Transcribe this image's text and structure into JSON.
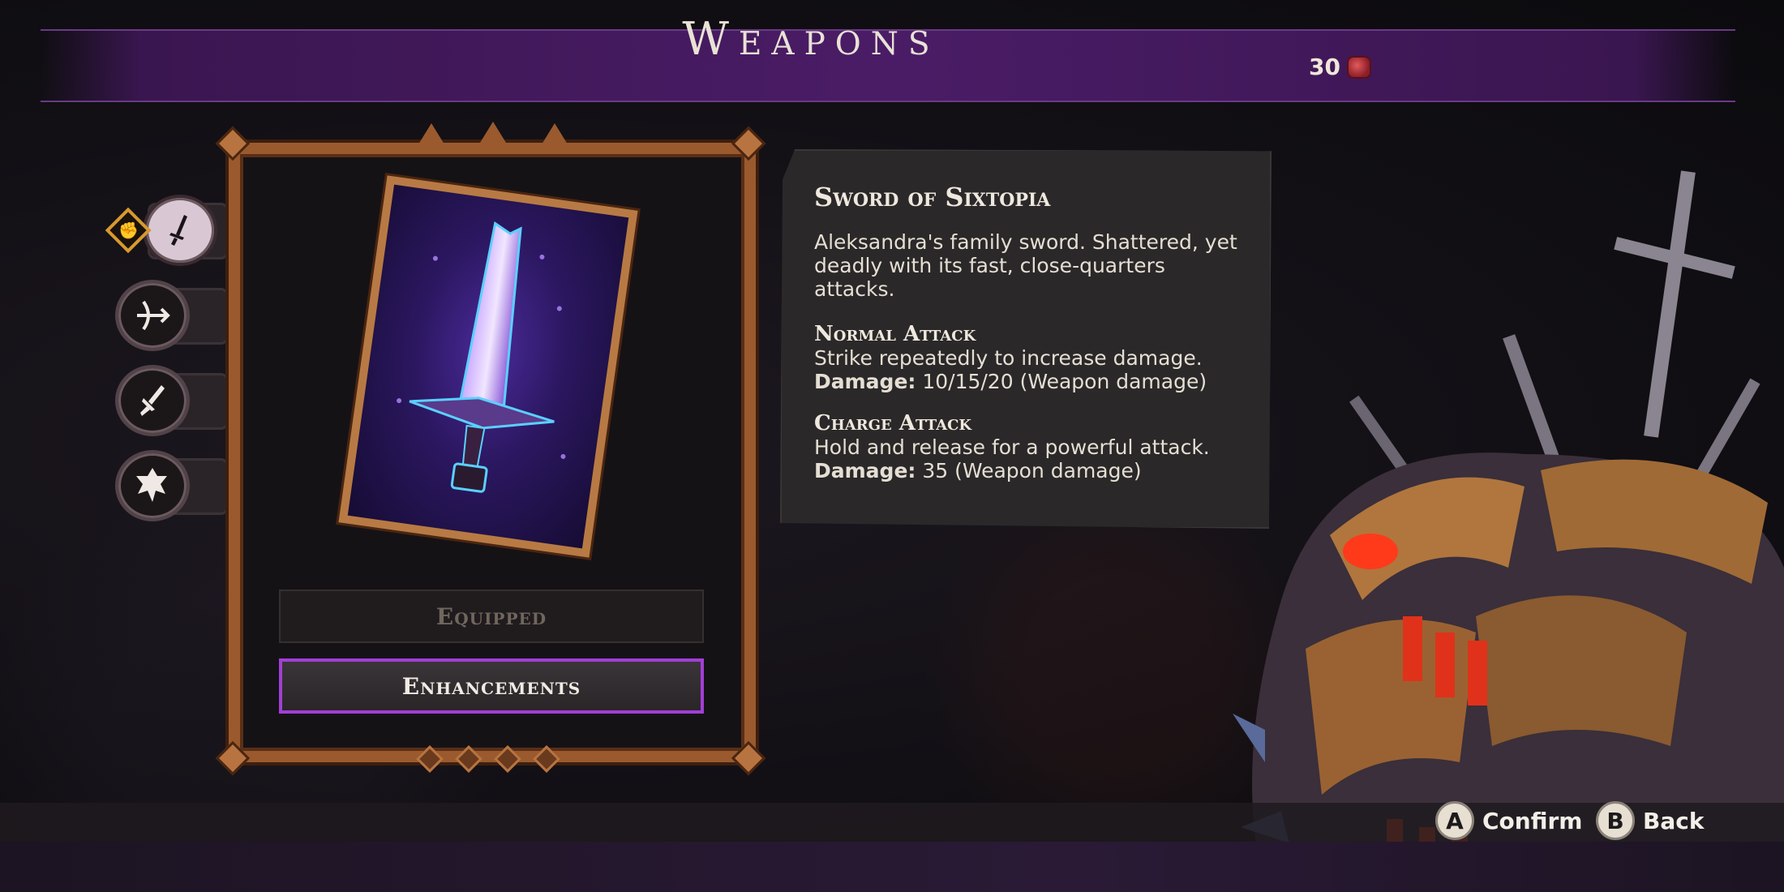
{
  "header": {
    "title": "Weapons",
    "currency_count": "30",
    "currency_icon": "gem-icon"
  },
  "tabs": [
    {
      "id": "sword",
      "icon": "sword-icon",
      "active": true
    },
    {
      "id": "crossbow",
      "icon": "crossbow-icon",
      "active": false
    },
    {
      "id": "dagger",
      "icon": "dagger-icon",
      "active": false
    },
    {
      "id": "gauntlet",
      "icon": "fist-icon",
      "active": false
    }
  ],
  "card": {
    "art_icon": "sword-icon",
    "equipped_label": "Equipped",
    "enhancements_label": "Enhancements"
  },
  "info": {
    "name": "Sword of Sixtopia",
    "description": "Aleksandra's family sword. Shattered, yet deadly with its fast, close-quarters attacks.",
    "normal_attack": {
      "title": "Normal Attack",
      "description": "Strike repeatedly to increase damage.",
      "damage_label": "Damage:",
      "damage_value": " 10/15/20 (Weapon damage)"
    },
    "charge_attack": {
      "title": "Charge Attack",
      "description": "Hold and release for a powerful attack.",
      "damage_label": "Damage:",
      "damage_value": " 35 (Weapon damage)"
    }
  },
  "controls": {
    "confirm_key": "A",
    "confirm_label": "Confirm",
    "back_key": "B",
    "back_label": "Back"
  },
  "colors": {
    "accent_purple": "#a23fd6",
    "frame_bronze": "#9a5a2e",
    "badge_gold": "#d89a2e"
  }
}
